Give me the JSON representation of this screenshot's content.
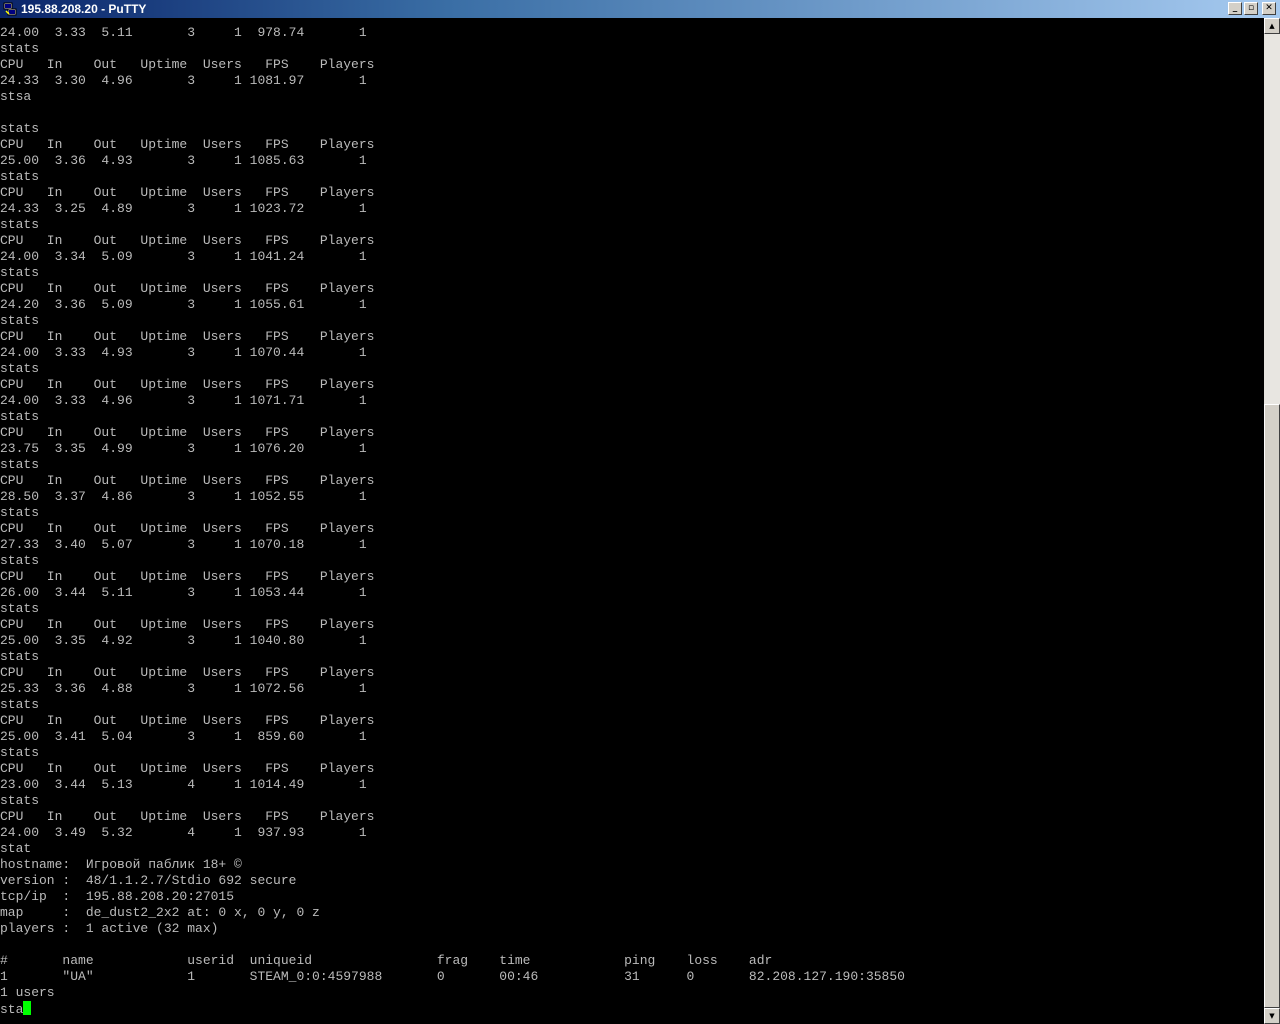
{
  "window": {
    "title": "195.88.208.20 - PuTTY",
    "icon": "putty-icon",
    "buttons": {
      "minimize": "minimize-icon",
      "maximize": "maximize-icon",
      "close": "close-icon"
    }
  },
  "terminal": {
    "output": "24.00  3.33  5.11       3     1  978.74       1\nstats\nCPU   In    Out   Uptime  Users   FPS    Players\n24.33  3.30  4.96       3     1 1081.97       1\nstsa\n\nstats\nCPU   In    Out   Uptime  Users   FPS    Players\n25.00  3.36  4.93       3     1 1085.63       1\nstats\nCPU   In    Out   Uptime  Users   FPS    Players\n24.33  3.25  4.89       3     1 1023.72       1\nstats\nCPU   In    Out   Uptime  Users   FPS    Players\n24.00  3.34  5.09       3     1 1041.24       1\nstats\nCPU   In    Out   Uptime  Users   FPS    Players\n24.20  3.36  5.09       3     1 1055.61       1\nstats\nCPU   In    Out   Uptime  Users   FPS    Players\n24.00  3.33  4.93       3     1 1070.44       1\nstats\nCPU   In    Out   Uptime  Users   FPS    Players\n24.00  3.33  4.96       3     1 1071.71       1\nstats\nCPU   In    Out   Uptime  Users   FPS    Players\n23.75  3.35  4.99       3     1 1076.20       1\nstats\nCPU   In    Out   Uptime  Users   FPS    Players\n28.50  3.37  4.86       3     1 1052.55       1\nstats\nCPU   In    Out   Uptime  Users   FPS    Players\n27.33  3.40  5.07       3     1 1070.18       1\nstats\nCPU   In    Out   Uptime  Users   FPS    Players\n26.00  3.44  5.11       3     1 1053.44       1\nstats\nCPU   In    Out   Uptime  Users   FPS    Players\n25.00  3.35  4.92       3     1 1040.80       1\nstats\nCPU   In    Out   Uptime  Users   FPS    Players\n25.33  3.36  4.88       3     1 1072.56       1\nstats\nCPU   In    Out   Uptime  Users   FPS    Players\n25.00  3.41  5.04       3     1  859.60       1\nstats\nCPU   In    Out   Uptime  Users   FPS    Players\n23.00  3.44  5.13       4     1 1014.49       1\nstats\nCPU   In    Out   Uptime  Users   FPS    Players\n24.00  3.49  5.32       4     1  937.93       1\nstat\nhostname:  Игровой паблик 18+ ©\nversion :  48/1.1.2.7/Stdio 692 secure\ntcp/ip  :  195.88.208.20:27015\nmap     :  de_dust2_2x2 at: 0 x, 0 y, 0 z\nplayers :  1 active (32 max)\n\n#       name            userid  uniqueid                frag    time            ping    loss    adr\n1       \"UA\"            1       STEAM_0:0:4597988       0       00:46           31      0       82.208.127.190:35850\n1 users",
    "prompt_input": "sta",
    "cursor_color": "#00ff00",
    "text_color": "#bbbbbb",
    "background_color": "#000000"
  },
  "scrollbar": {
    "up_icon": "scroll-up-arrow-icon",
    "down_icon": "scroll-down-arrow-icon"
  }
}
